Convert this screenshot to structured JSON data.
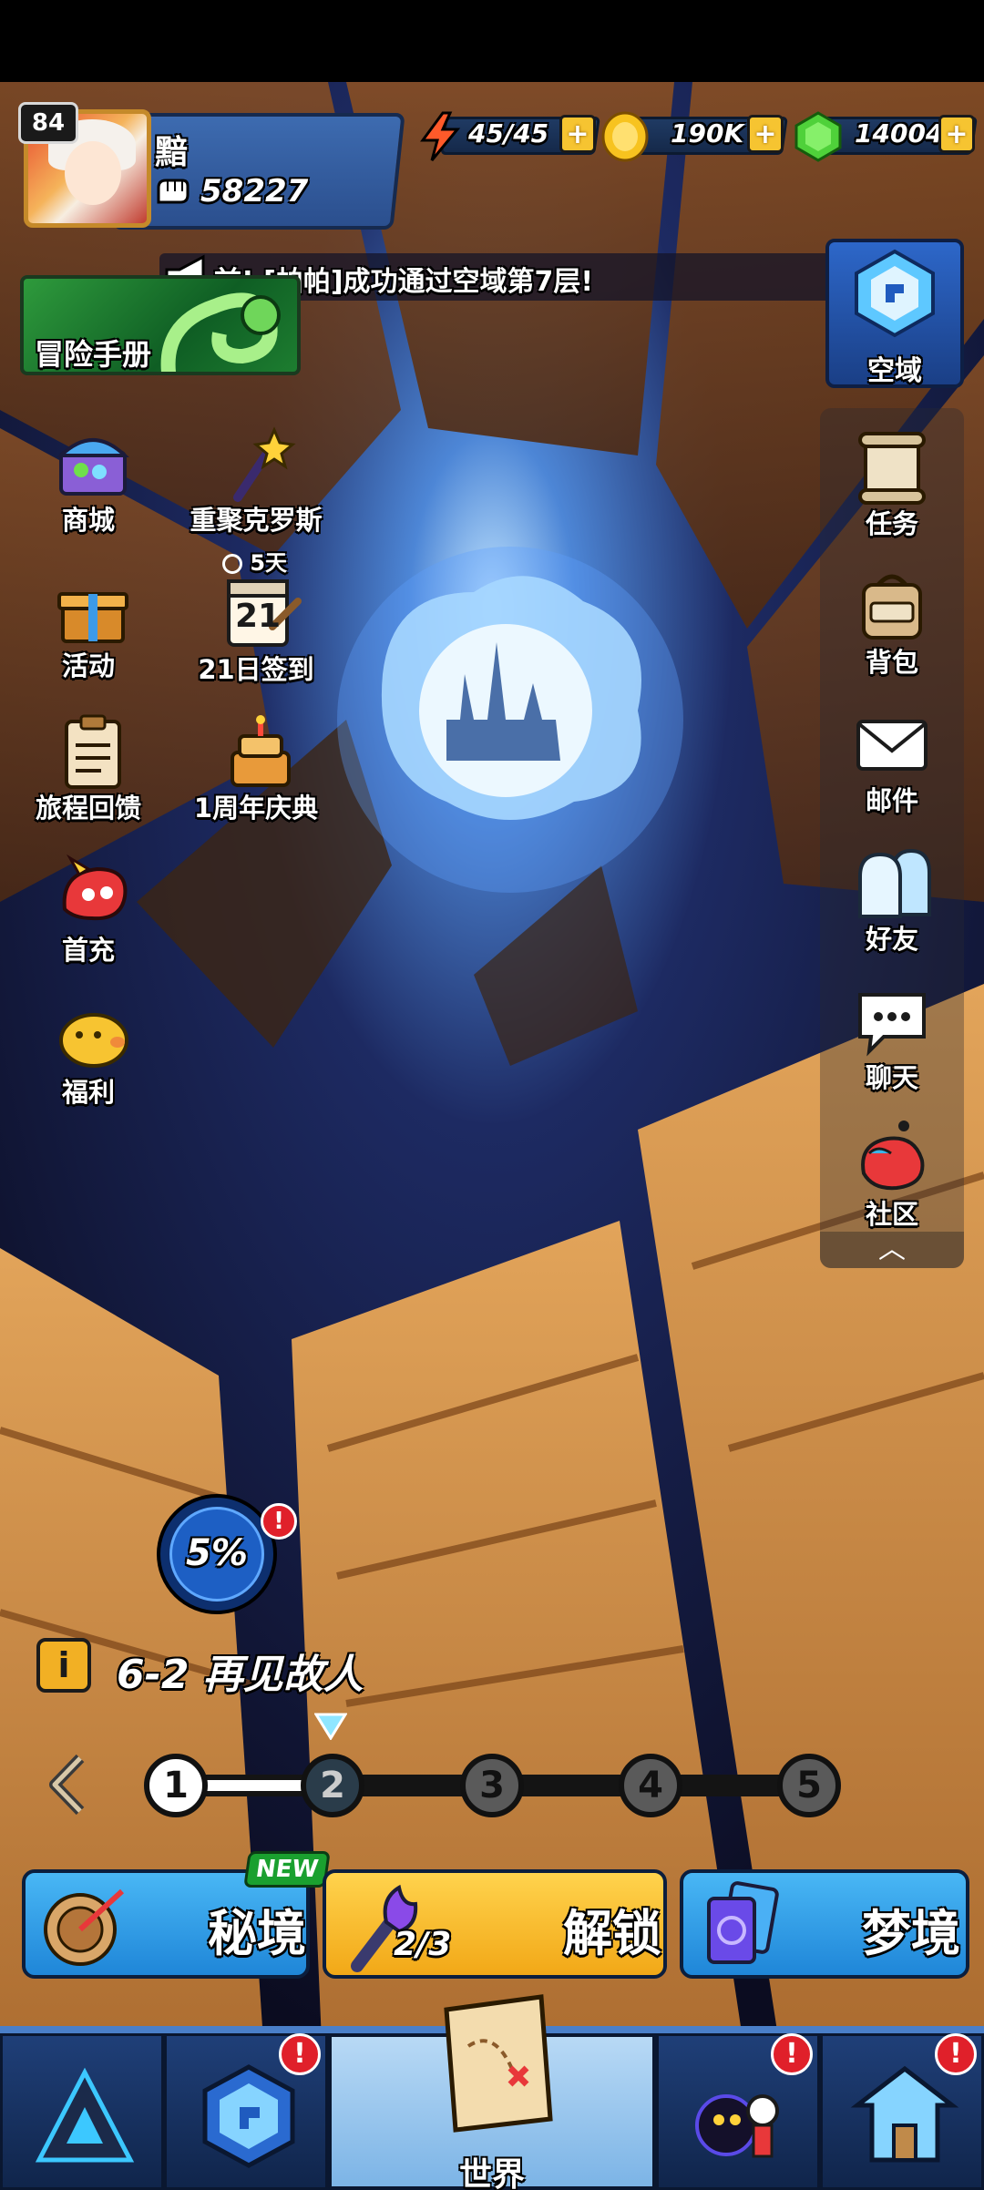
{
  "player": {
    "level": "84",
    "name": "黯",
    "power": "58227"
  },
  "resources": {
    "energy": "45/45",
    "gold": "190K",
    "gems": "14004"
  },
  "broadcast": {
    "text": "前! [帕帕]成功通过空域第7层!"
  },
  "adventure_manual": {
    "label": "冒险手册"
  },
  "sky_domain": {
    "label": "空域"
  },
  "left_menu": {
    "shop": "商城",
    "reunion": "重聚克罗斯",
    "event": "活动",
    "signin_timer": "5天",
    "signin_day": "21",
    "signin": "21日签到",
    "journey": "旅程回馈",
    "anniversary": "1周年庆典",
    "first_charge": "首充",
    "welfare": "福利"
  },
  "right_menu": {
    "tasks": "任务",
    "bag": "背包",
    "mail": "邮件",
    "friends": "好友",
    "chat": "聊天",
    "community": "社区"
  },
  "progress": {
    "percent": "5%",
    "alert": "!"
  },
  "stage": {
    "info_icon": "i",
    "name": "6-2 再见故人"
  },
  "chapters": {
    "nodes": [
      "1",
      "2",
      "3",
      "4",
      "5"
    ],
    "completed": 1,
    "current": 2
  },
  "modes": {
    "secret": "秘境",
    "new_badge": "NEW",
    "unlock": "解锁",
    "unlock_progress": "2/3",
    "dream": "梦境"
  },
  "bottom_nav": {
    "world": "世界",
    "alert": "!"
  },
  "colors": {
    "accent_blue": "#2b4f8e",
    "gold": "#f6c431",
    "alert_red": "#e0202a"
  }
}
